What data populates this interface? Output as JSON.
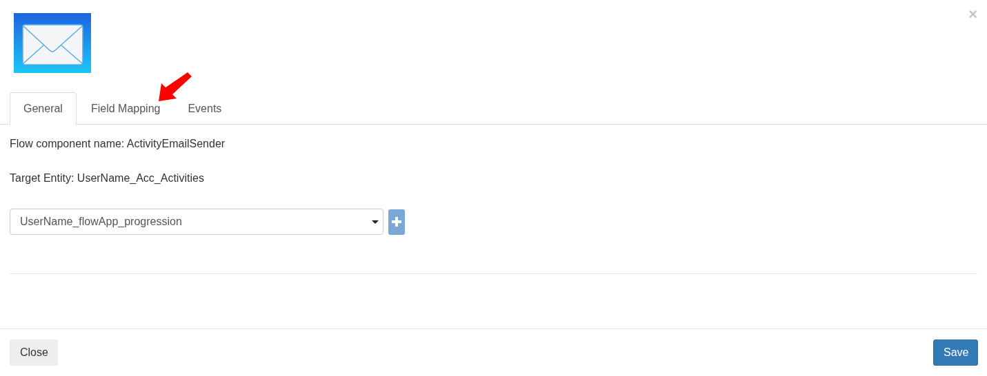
{
  "close_glyph": "×",
  "tabs": [
    {
      "label": "General",
      "selected": true
    },
    {
      "label": "Field Mapping",
      "selected": false
    },
    {
      "label": "Events",
      "selected": false
    }
  ],
  "annotation": {
    "kind": "arrow"
  },
  "fields": [
    {
      "label": "Flow component name: ActivityEmailSender"
    },
    {
      "label": "Target Entity: UserName_Acc_Activities"
    }
  ],
  "select": {
    "value": "UserName_flowApp_progression"
  },
  "footer": {
    "close": "Close",
    "save": "Save"
  }
}
